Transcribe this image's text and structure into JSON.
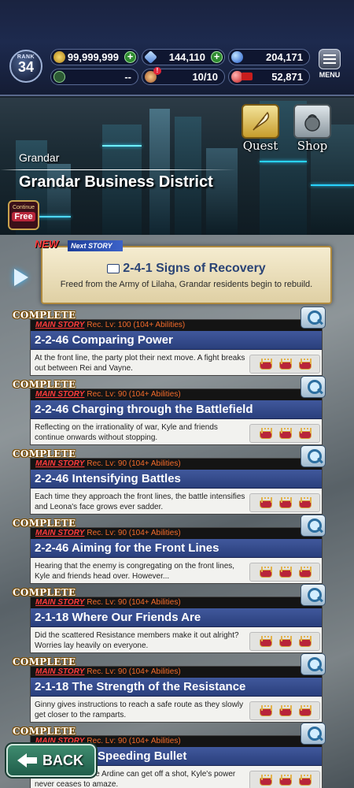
{
  "header": {
    "rank_label": "RANK",
    "rank_value": "34",
    "gil": "99,999,999",
    "crystals": "144,110",
    "blue_orbs": "204,171",
    "stat4": "--",
    "stamina": "10/10",
    "red_items": "52,871",
    "menu_label": "MENU",
    "stamina_badge": "!"
  },
  "banner": {
    "subtitle": "Grandar",
    "title": "Grandar Business District",
    "continue_label": "Continue",
    "continue_badge": "Free",
    "quest_label": "Quest",
    "shop_label": "Shop"
  },
  "next_story": {
    "new_label": "NEW",
    "tag": "Next STORY",
    "title": "2-4-1 Signs of Recovery",
    "desc": "Freed from the Army of Lilaha, Grandar residents begin to rebuild."
  },
  "stories": [
    {
      "complete": "COMPLETE",
      "tag": "MAIN STORY",
      "rec": "Rec. Lv: 100 (104+ Abilities)",
      "title": "2-2-46 Comparing Power",
      "desc": "At the front line, the party plot their next move. A fight breaks out between Rei and Vayne."
    },
    {
      "complete": "COMPLETE",
      "tag": "MAIN STORY",
      "rec": "Rec. Lv: 90 (104+ Abilities)",
      "title": "2-2-46 Charging through the Battlefield",
      "desc": "Reflecting on the irrationality of war, Kyle and friends continue onwards without stopping."
    },
    {
      "complete": "COMPLETE",
      "tag": "MAIN STORY",
      "rec": "Rec. Lv: 90 (104+ Abilities)",
      "title": "2-2-46 Intensifying Battles",
      "desc": "Each time they approach the front lines, the battle intensifies and Leona's face grows ever sadder."
    },
    {
      "complete": "COMPLETE",
      "tag": "MAIN STORY",
      "rec": "Rec. Lv: 90 (104+ Abilities)",
      "title": "2-2-46 Aiming for the Front Lines",
      "desc": "Hearing that the enemy is congregating on the front lines, Kyle and friends head over. However..."
    },
    {
      "complete": "COMPLETE",
      "tag": "MAIN STORY",
      "rec": "Rec. Lv: 90 (104+ Abilities)",
      "title": "2-1-18 Where Our Friends Are",
      "desc": "Did the scattered Resistance members make it out alright? Worries lay heavily on everyone."
    },
    {
      "complete": "COMPLETE",
      "tag": "MAIN STORY",
      "rec": "Rec. Lv: 90 (104+ Abilities)",
      "title": "2-1-18 The Strength of the Resistance",
      "desc": "Ginny gives instructions to reach a safe route as they slowly get closer to the ramparts."
    },
    {
      "complete": "COMPLETE",
      "tag": "MAIN STORY",
      "rec": "Rec. Lv: 90 (104+ Abilities)",
      "title": "ster than a Speeding Bullet",
      "desc": "...hue to fall before Ardine can get off a shot, Kyle's power never ceases to amaze."
    }
  ],
  "back_label": "BACK"
}
